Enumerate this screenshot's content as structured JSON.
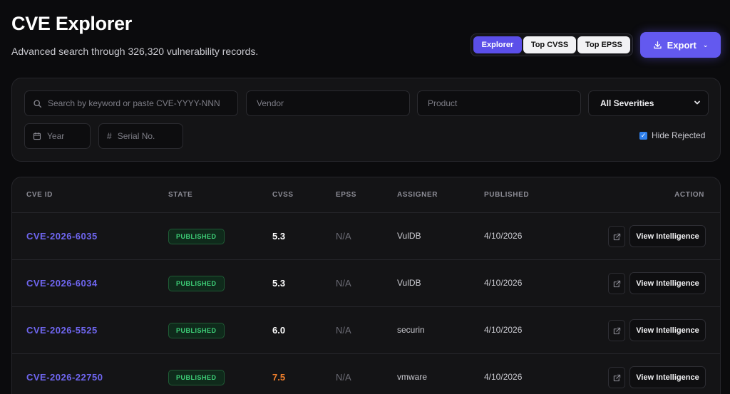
{
  "header": {
    "title": "CVE Explorer",
    "subtitle": "Advanced search through 326,320 vulnerability records."
  },
  "view_tabs": [
    {
      "label": "Explorer",
      "active": true
    },
    {
      "label": "Top CVSS",
      "active": false
    },
    {
      "label": "Top EPSS",
      "active": false
    }
  ],
  "export": {
    "label": "Export",
    "icon": "download-icon"
  },
  "filters": {
    "search_placeholder": "Search by keyword or paste CVE-YYYY-NNN",
    "vendor_placeholder": "Vendor",
    "product_placeholder": "Product",
    "severity_selected": "All Severities",
    "year_placeholder": "Year",
    "serial_placeholder": "Serial No.",
    "hide_rejected_label": "Hide Rejected",
    "hide_rejected_checked": true
  },
  "table": {
    "columns": [
      "CVE ID",
      "STATE",
      "CVSS",
      "EPSS",
      "ASSIGNER",
      "PUBLISHED",
      "ACTION"
    ],
    "action_label": "View Intelligence",
    "rows": [
      {
        "cve": "CVE-2026-6035",
        "state": "PUBLISHED",
        "cvss": "5.3",
        "epss": "N/A",
        "assigner": "VulDB",
        "published": "4/10/2026"
      },
      {
        "cve": "CVE-2026-6034",
        "state": "PUBLISHED",
        "cvss": "5.3",
        "epss": "N/A",
        "assigner": "VulDB",
        "published": "4/10/2026"
      },
      {
        "cve": "CVE-2026-5525",
        "state": "PUBLISHED",
        "cvss": "6.0",
        "epss": "N/A",
        "assigner": "securin",
        "published": "4/10/2026"
      },
      {
        "cve": "CVE-2026-22750",
        "state": "PUBLISHED",
        "cvss": "7.5",
        "epss": "N/A",
        "assigner": "vmware",
        "published": "4/10/2026"
      }
    ]
  },
  "colors": {
    "accent": "#6359ef",
    "cve_link": "#6f66f0",
    "published_badge": "#3fd37a",
    "cvss_high": "#f2802c"
  }
}
